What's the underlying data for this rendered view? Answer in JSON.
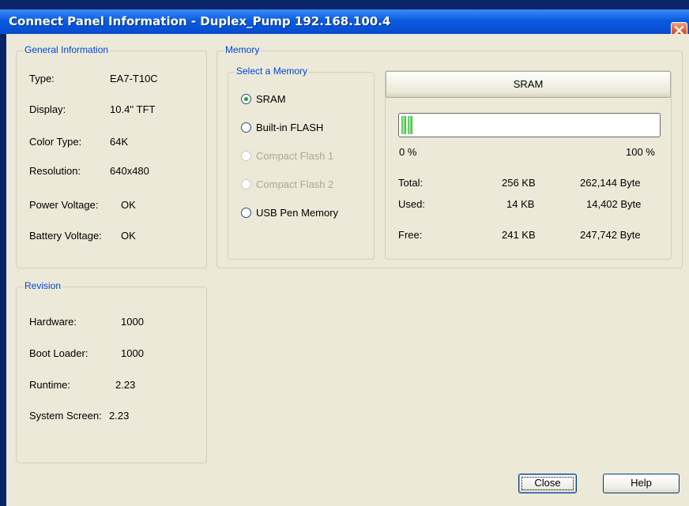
{
  "window": {
    "title": "Connect Panel Information - Duplex_Pump 192.168.100.4"
  },
  "general": {
    "legend": "General Information",
    "rows": [
      {
        "label": "Type:",
        "value": "EA7-T10C"
      },
      {
        "label": "Display:",
        "value": "10.4'' TFT"
      },
      {
        "label": "Color Type:",
        "value": "64K"
      },
      {
        "label": "Resolution:",
        "value": "640x480"
      },
      {
        "label": "Power Voltage:",
        "value": "OK"
      },
      {
        "label": "Battery Voltage:",
        "value": "OK"
      }
    ]
  },
  "revision": {
    "legend": "Revision",
    "rows": [
      {
        "label": "Hardware:",
        "value": "1000"
      },
      {
        "label": "Boot Loader:",
        "value": "1000"
      },
      {
        "label": "Runtime:",
        "value": "2.23"
      },
      {
        "label": "System Screen:",
        "value": "2.23"
      }
    ]
  },
  "memory": {
    "legend": "Memory",
    "select_legend": "Select a Memory",
    "options": [
      {
        "label": "SRAM",
        "selected": true,
        "enabled": true
      },
      {
        "label": "Built-in FLASH",
        "selected": false,
        "enabled": true
      },
      {
        "label": "Compact Flash 1",
        "selected": false,
        "enabled": false
      },
      {
        "label": "Compact Flash 2",
        "selected": false,
        "enabled": false
      },
      {
        "label": "USB Pen Memory",
        "selected": false,
        "enabled": true
      }
    ],
    "selected_name": "SRAM",
    "usage_fraction": 0.055,
    "scale_min": "0 %",
    "scale_max": "100 %",
    "stats": [
      {
        "label": "Total:",
        "kb": "256 KB",
        "bytes": "262,144 Byte"
      },
      {
        "label": "Used:",
        "kb": "14 KB",
        "bytes": "14,402 Byte"
      },
      {
        "label": "Free:",
        "kb": "241 KB",
        "bytes": "247,742 Byte"
      }
    ]
  },
  "buttons": {
    "close": "Close",
    "help": "Help"
  },
  "colors": {
    "legend_text": "#0046d5",
    "progress_green": "#3fbf3f",
    "selected_radio": "#21a121"
  }
}
